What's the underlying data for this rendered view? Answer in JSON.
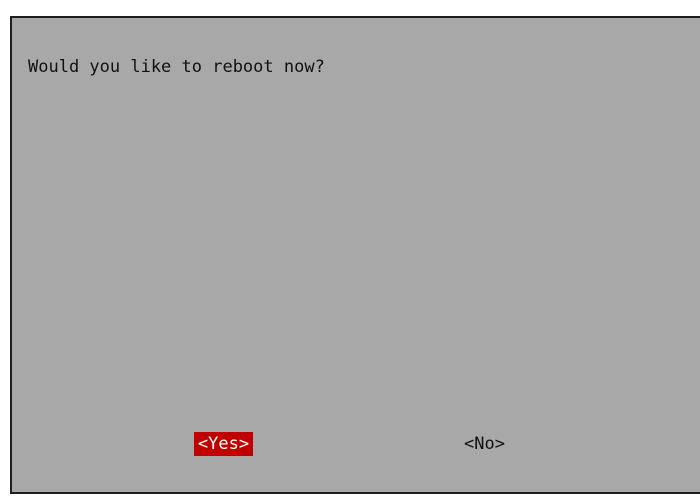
{
  "dialog": {
    "message": "Would you like to reboot now?",
    "buttons": [
      {
        "label": "<Yes>",
        "selected": true
      },
      {
        "label": "<No>",
        "selected": false
      }
    ]
  },
  "colors": {
    "dialog_background": "#a8a8a8",
    "border": "#1e1e1e",
    "selected_button_background": "#c00000",
    "selected_button_text": "#ffffff",
    "text": "#111111"
  }
}
